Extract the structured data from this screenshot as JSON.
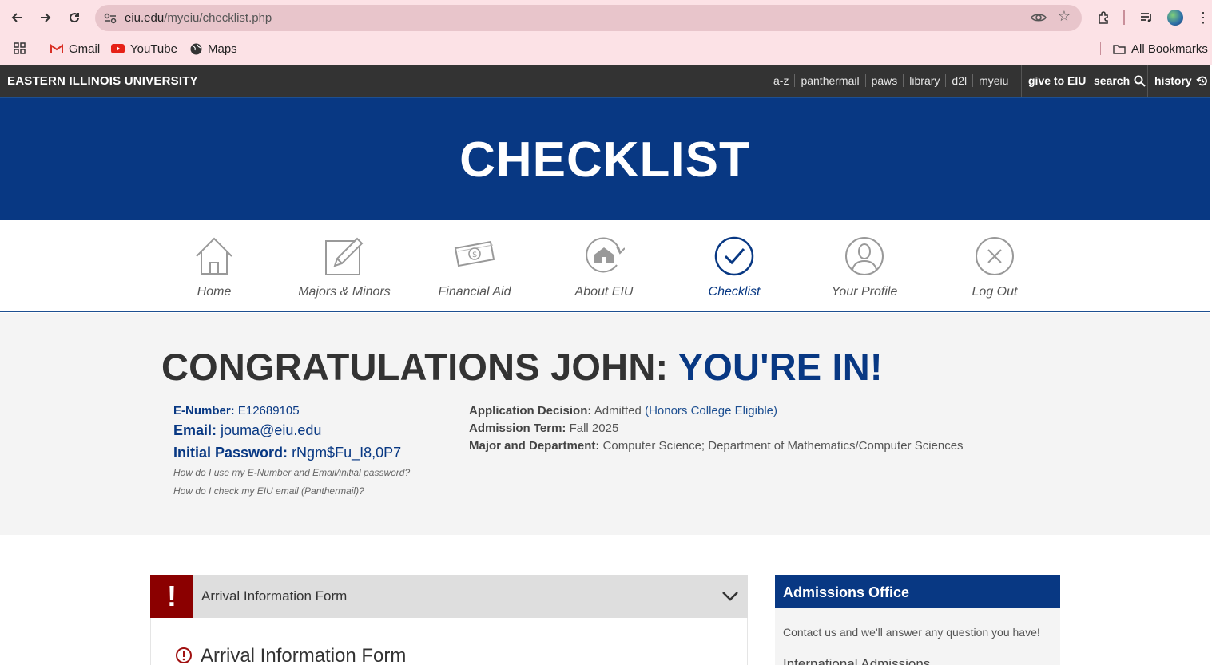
{
  "browser": {
    "url_domain": "eiu.edu",
    "url_path": "/myeiu/checklist.php",
    "bookmarks": [
      "Gmail",
      "YouTube",
      "Maps"
    ],
    "all_bookmarks": "All Bookmarks"
  },
  "topbar": {
    "brand": "EASTERN ILLINOIS UNIVERSITY",
    "links": [
      "a-z",
      "panthermail",
      "paws",
      "library",
      "d2l",
      "myeiu"
    ],
    "give": "give to EIU",
    "search": "search",
    "history": "history"
  },
  "hero": {
    "title": "CHECKLIST"
  },
  "nav": {
    "items": [
      {
        "label": "Home",
        "icon": "home-icon"
      },
      {
        "label": "Majors & Minors",
        "icon": "edit-icon"
      },
      {
        "label": "Financial Aid",
        "icon": "money-icon"
      },
      {
        "label": "About EIU",
        "icon": "campus-icon"
      },
      {
        "label": "Checklist",
        "icon": "check-icon"
      },
      {
        "label": "Your Profile",
        "icon": "profile-icon"
      },
      {
        "label": "Log Out",
        "icon": "close-icon"
      }
    ],
    "active": "Checklist"
  },
  "congrats": {
    "heading_main": "CONGRATULATIONS JOHN:",
    "heading_accent": "YOU'RE IN!",
    "enumber_label": "E-Number:",
    "enumber": "E12689105",
    "email_label": "Email:",
    "email": "jouma@eiu.edu",
    "password_label": "Initial Password:",
    "password": "rNgm$Fu_I8,0P7",
    "help1": "How do I use my E-Number and Email/initial password?",
    "help2": "How do I check my EIU email (Panthermail)?",
    "decision_label": "Application Decision:",
    "decision": "Admitted",
    "decision_note": "(Honors College Eligible)",
    "term_label": "Admission Term:",
    "term": "Fall 2025",
    "major_label": "Major and Department:",
    "major": "Computer Science; Department of Mathematics/Computer Sciences"
  },
  "accordion": {
    "title": "Arrival Information Form",
    "body_title": "Arrival Information Form"
  },
  "sidebar": {
    "title": "Admissions Office",
    "text": "Contact us and we'll answer any question you have!",
    "sub": "International Admissions"
  },
  "colors": {
    "navy": "#083883",
    "alert": "#8b0000",
    "topbar": "#333333"
  }
}
